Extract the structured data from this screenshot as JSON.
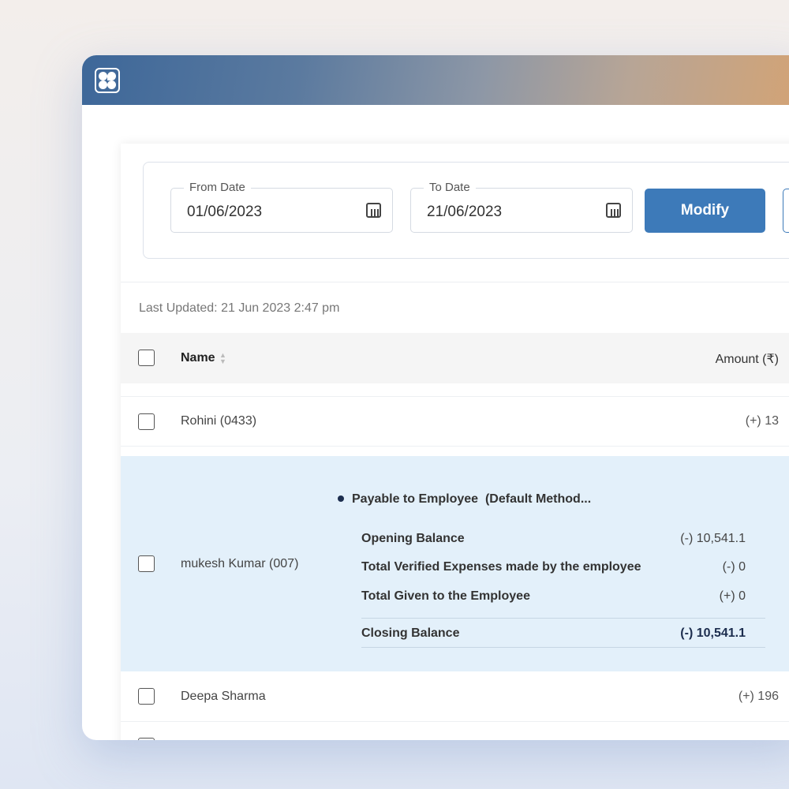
{
  "filter": {
    "from_label": "From Date",
    "from_value": "01/06/2023",
    "to_label": "To Date",
    "to_value": "21/06/2023",
    "modify_label": "Modify"
  },
  "last_updated": "Last Updated: 21 Jun 2023 2:47 pm",
  "table": {
    "col_name": "Name",
    "col_amount": "Amount (₹)",
    "rows": [
      {
        "name": "Rohini (0433)",
        "amount": "(+) 13"
      },
      {
        "name": "mukesh Kumar (007)",
        "amount": ""
      },
      {
        "name": "Deepa Sharma",
        "amount": "(+) 196"
      }
    ]
  },
  "expanded": {
    "title": "Payable to Employee  (Default Method...",
    "lines": [
      {
        "label": "Opening Balance",
        "value": "(-) 10,541.1"
      },
      {
        "label": "Total Verified Expenses made by the employee",
        "value": "(-) 0"
      },
      {
        "label": "Total Given to the Employee",
        "value": "(+) 0"
      }
    ],
    "closing": {
      "label": "Closing Balance",
      "value": "(-) 10,541.1"
    }
  },
  "colors": {
    "accent": "#3d7ab9",
    "expanded_bg": "#e3f0fa"
  }
}
